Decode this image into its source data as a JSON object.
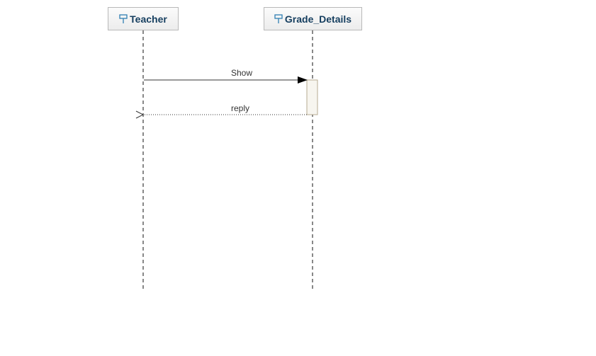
{
  "diagram": {
    "type": "sequence",
    "lifelines": [
      {
        "id": "teacher",
        "label": "Teacher",
        "icon": "actor-pin-icon"
      },
      {
        "id": "grade_details",
        "label": "Grade_Details",
        "icon": "actor-pin-icon"
      }
    ],
    "messages": [
      {
        "label": "Show",
        "from": "Teacher",
        "to": "Grade_Details",
        "style": "solid",
        "arrow": "filled"
      },
      {
        "label": "reply",
        "from": "Grade_Details",
        "to": "Teacher",
        "style": "dotted",
        "arrow": "open"
      }
    ]
  },
  "colors": {
    "lifeline_text": "#153e5f",
    "icon": "#2f7fb3",
    "lifeline_line": "#888888",
    "activation_fill": "#f7f5ef",
    "activation_border": "#b7ab92",
    "message_line": "#333333"
  }
}
